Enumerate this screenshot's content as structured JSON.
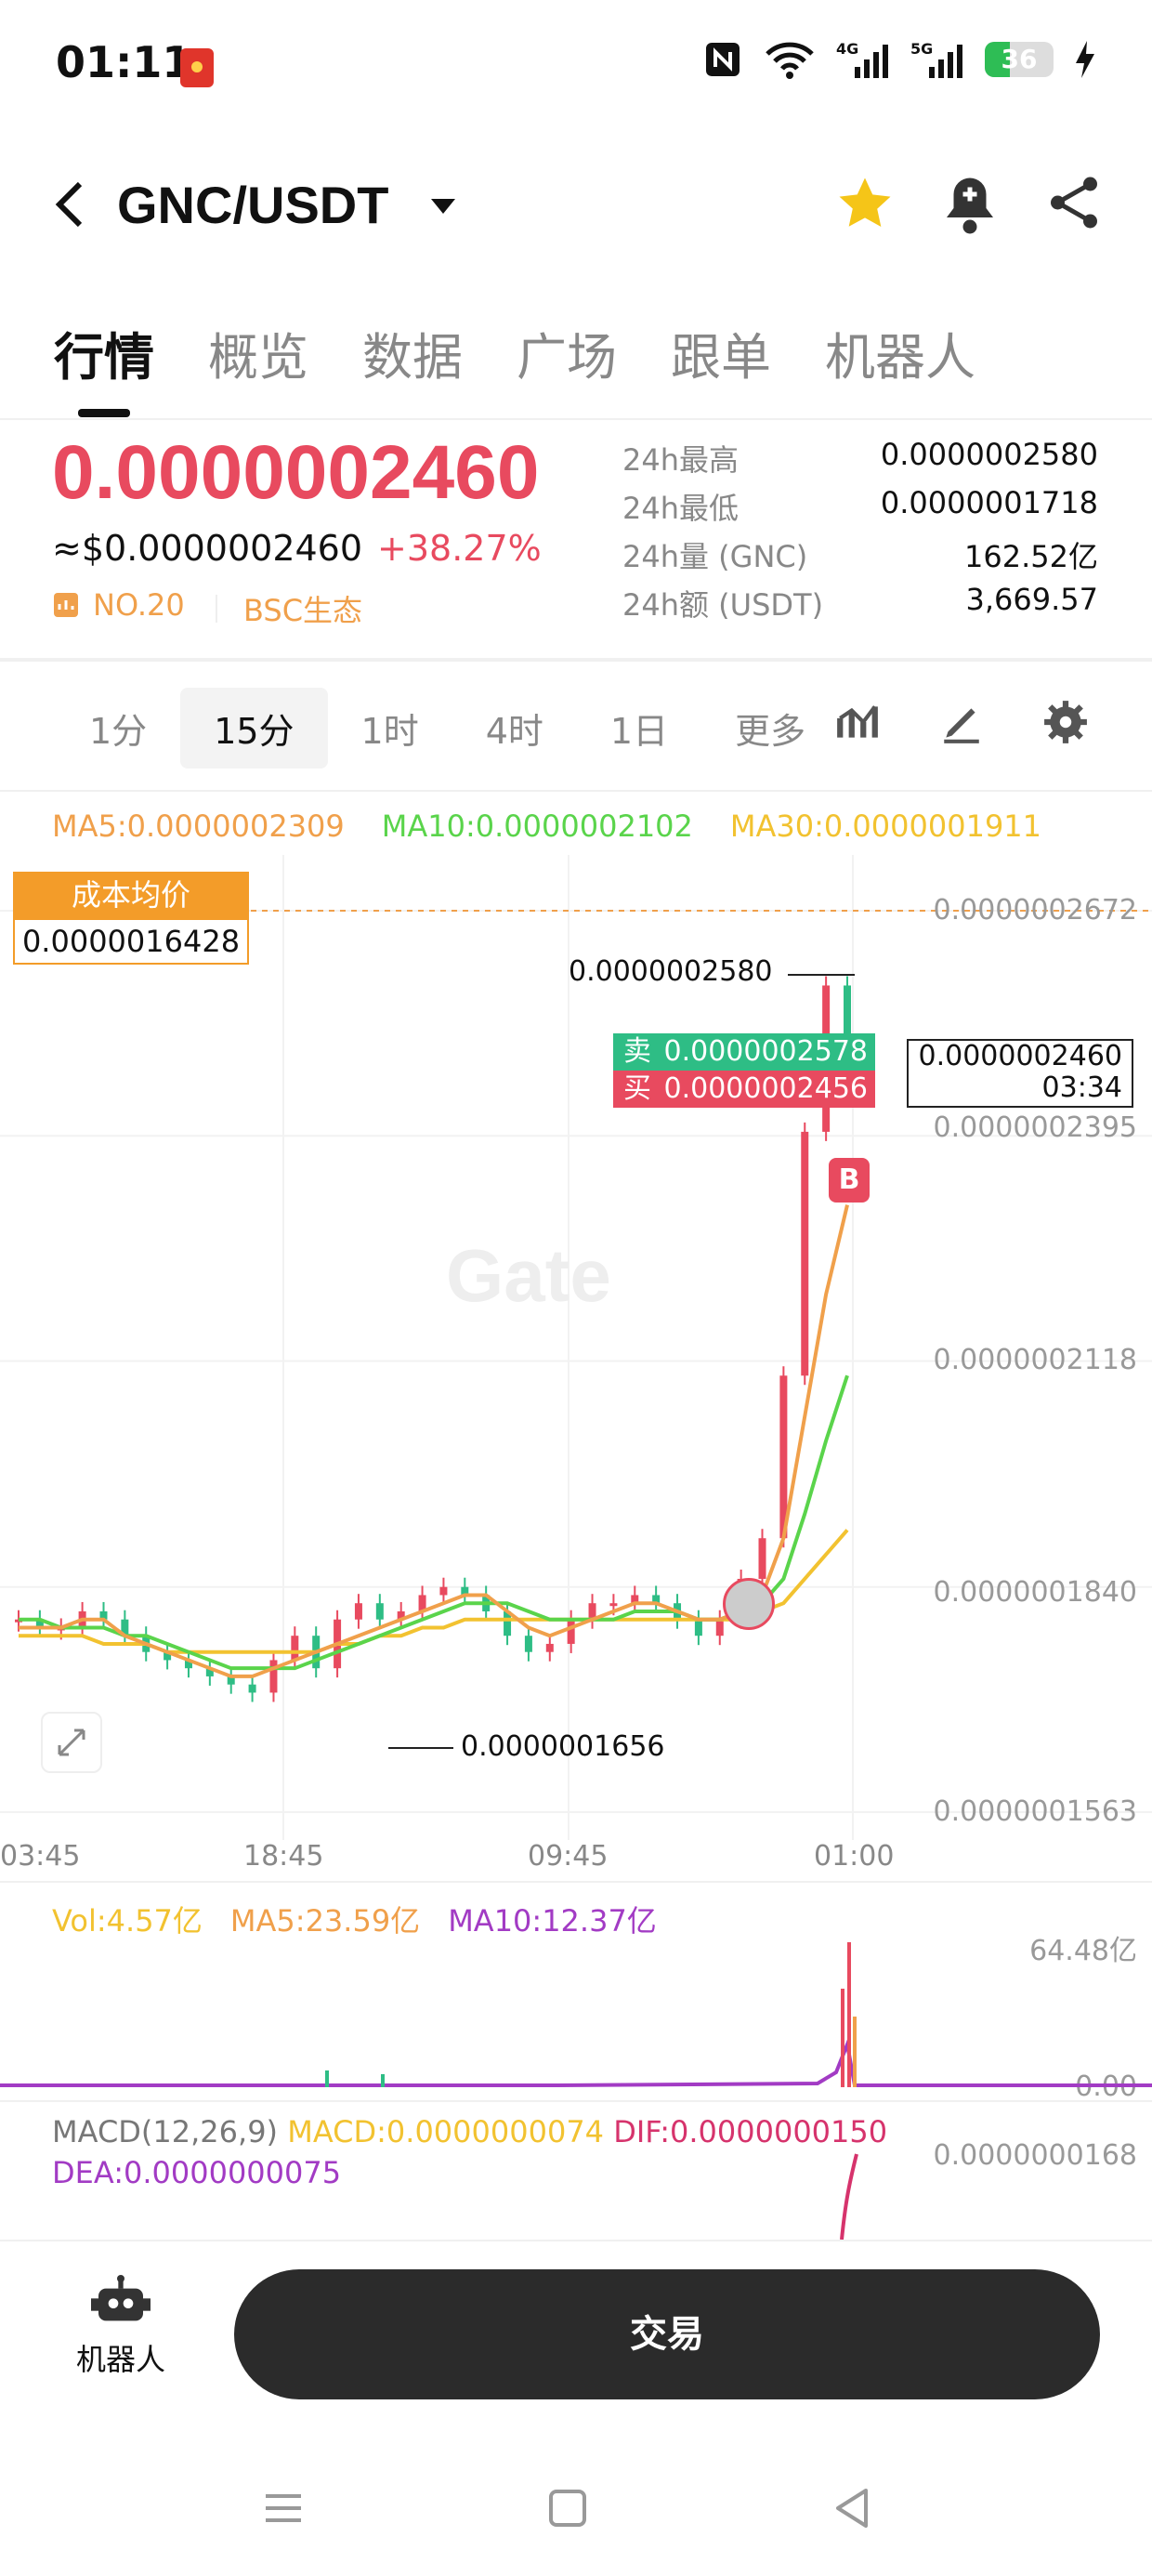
{
  "status": {
    "time": "01:11",
    "battery": "36",
    "battery_level": 0.36
  },
  "header": {
    "pair": "GNC/USDT"
  },
  "tabs": [
    "行情",
    "概览",
    "数据",
    "广场",
    "跟单",
    "机器人"
  ],
  "price": {
    "last": "0.0000002460",
    "usd": "≈$0.0000002460",
    "change": "+38.27%",
    "rank": "NO.20",
    "ecosystem": "BSC生态"
  },
  "stats": [
    {
      "label": "24h最高",
      "value": "0.0000002580"
    },
    {
      "label": "24h最低",
      "value": "0.0000001718"
    },
    {
      "label": "24h量 (GNC)",
      "value": "162.52亿"
    },
    {
      "label": "24h额 (USDT)",
      "value": "3,669.57"
    }
  ],
  "intervals": [
    "1分",
    "15分",
    "1时",
    "4时",
    "1日",
    "更多"
  ],
  "ma": {
    "ma5": "MA5:0.0000002309",
    "ma10": "MA10:0.0000002102",
    "ma30": "MA30:0.0000001911"
  },
  "cost": {
    "title": "成本均价",
    "value": "0.0000016428"
  },
  "orderbook": {
    "sell_label": "卖",
    "sell": "0.0000002578",
    "buy_label": "买",
    "buy": "0.0000002456"
  },
  "last_box": {
    "price": "0.0000002460",
    "countdown": "03:34"
  },
  "marker": "B",
  "watermark": "Gate",
  "annotations": {
    "high": "0.0000002580",
    "low": "0.0000001656"
  },
  "vol": {
    "vol": "Vol:4.57亿",
    "ma5": "MA5:23.59亿",
    "ma10": "MA10:12.37亿",
    "ymax": "64.48亿",
    "ymin": "0.00"
  },
  "macd": {
    "title": "MACD(12,26,9)",
    "macd": "MACD:0.0000000074",
    "dif": "DIF:0.0000000150",
    "dea": "DEA:0.0000000075",
    "ymax": "0.0000000168"
  },
  "bottom": {
    "bot_label": "机器人",
    "trade_label": "交易"
  },
  "colors": {
    "up": "#e84a5f",
    "down": "#2ebd85",
    "ma5": "#f0a04b",
    "ma10": "#5ad44b",
    "ma30": "#f2c230",
    "purple": "#a23bc4"
  },
  "chart_data": {
    "type": "candlestick",
    "x_ticks": [
      "03:45",
      "18:45",
      "09:45",
      "01:00"
    ],
    "y_ticks": [
      2.672e-07,
      2.395e-07,
      2.118e-07,
      1.84e-07,
      1.563e-07
    ],
    "ylim": [
      1.563e-07,
      2.672e-07
    ],
    "close": [
      1.8e-07,
      1.79e-07,
      1.79e-07,
      1.81e-07,
      1.8e-07,
      1.78e-07,
      1.76e-07,
      1.75e-07,
      1.74e-07,
      1.73e-07,
      1.72e-07,
      1.71e-07,
      1.75e-07,
      1.78e-07,
      1.74e-07,
      1.8e-07,
      1.82e-07,
      1.8e-07,
      1.81e-07,
      1.83e-07,
      1.84e-07,
      1.83e-07,
      1.81e-07,
      1.78e-07,
      1.76e-07,
      1.77e-07,
      1.8e-07,
      1.82e-07,
      1.82e-07,
      1.83e-07,
      1.82e-07,
      1.8e-07,
      1.78e-07,
      1.8e-07,
      1.85e-07,
      1.9e-07,
      2.1e-07,
      2.4e-07,
      2.58e-07,
      2.46e-07
    ],
    "ma5_line": [
      1.79e-07,
      1.79e-07,
      1.79e-07,
      1.8e-07,
      1.8e-07,
      1.78e-07,
      1.77e-07,
      1.76e-07,
      1.75e-07,
      1.74e-07,
      1.73e-07,
      1.73e-07,
      1.74e-07,
      1.75e-07,
      1.76e-07,
      1.77e-07,
      1.78e-07,
      1.79e-07,
      1.8e-07,
      1.81e-07,
      1.82e-07,
      1.83e-07,
      1.83e-07,
      1.81e-07,
      1.79e-07,
      1.78e-07,
      1.79e-07,
      1.8e-07,
      1.81e-07,
      1.82e-07,
      1.82e-07,
      1.81e-07,
      1.8e-07,
      1.8e-07,
      1.81e-07,
      1.83e-07,
      1.9e-07,
      2.05e-07,
      2.2e-07,
      2.31e-07
    ],
    "ma10_line": [
      1.8e-07,
      1.8e-07,
      1.79e-07,
      1.79e-07,
      1.79e-07,
      1.78e-07,
      1.78e-07,
      1.77e-07,
      1.76e-07,
      1.75e-07,
      1.74e-07,
      1.74e-07,
      1.74e-07,
      1.74e-07,
      1.75e-07,
      1.76e-07,
      1.77e-07,
      1.78e-07,
      1.79e-07,
      1.8e-07,
      1.81e-07,
      1.82e-07,
      1.82e-07,
      1.82e-07,
      1.81e-07,
      1.8e-07,
      1.8e-07,
      1.8e-07,
      1.8e-07,
      1.81e-07,
      1.81e-07,
      1.81e-07,
      1.8e-07,
      1.8e-07,
      1.81e-07,
      1.82e-07,
      1.85e-07,
      1.93e-07,
      2.02e-07,
      2.1e-07
    ],
    "ma30_line": [
      1.78e-07,
      1.78e-07,
      1.78e-07,
      1.78e-07,
      1.77e-07,
      1.77e-07,
      1.77e-07,
      1.76e-07,
      1.76e-07,
      1.76e-07,
      1.76e-07,
      1.76e-07,
      1.76e-07,
      1.76e-07,
      1.76e-07,
      1.77e-07,
      1.77e-07,
      1.78e-07,
      1.78e-07,
      1.79e-07,
      1.79e-07,
      1.8e-07,
      1.8e-07,
      1.8e-07,
      1.8e-07,
      1.8e-07,
      1.8e-07,
      1.8e-07,
      1.8e-07,
      1.8e-07,
      1.8e-07,
      1.8e-07,
      1.8e-07,
      1.8e-07,
      1.8e-07,
      1.81e-07,
      1.82e-07,
      1.85e-07,
      1.88e-07,
      1.91e-07
    ]
  }
}
